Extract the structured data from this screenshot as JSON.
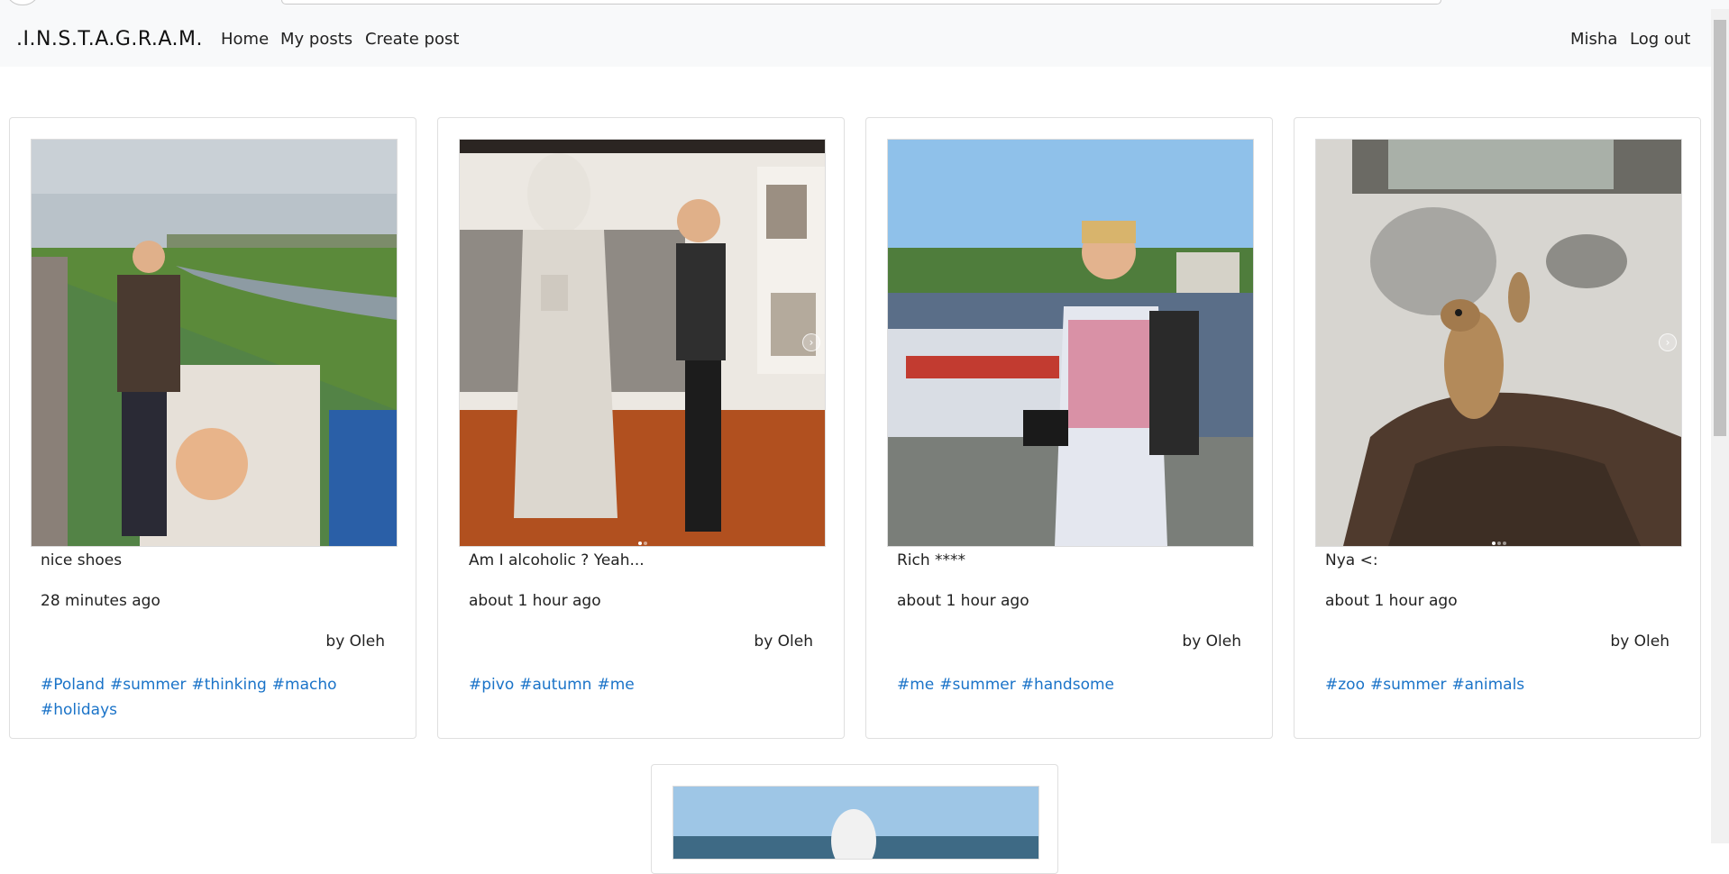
{
  "navbar": {
    "brand": ".I.N.S.T.A.G.R.A.M.",
    "links": [
      "Home",
      "My posts",
      "Create post"
    ],
    "user": "Misha",
    "logout": "Log out"
  },
  "posts": [
    {
      "caption": "nice shoes",
      "time": "28 minutes ago",
      "author": "by Oleh",
      "tags": [
        "#Poland",
        "#summer",
        "#thinking",
        "#macho",
        "#holidays"
      ],
      "has_carousel": false,
      "photo_icon": "riverside-photo"
    },
    {
      "caption": "Am I alcoholic ? Yeah...",
      "time": "about 1 hour ago",
      "author": "by Oleh",
      "tags": [
        "#pivo",
        "#autumn",
        "#me"
      ],
      "has_carousel": true,
      "photo_icon": "statue-photo"
    },
    {
      "caption": "Rich ****",
      "time": "about 1 hour ago",
      "author": "by Oleh",
      "tags": [
        "#me",
        "#summer",
        "#handsome"
      ],
      "has_carousel": false,
      "photo_icon": "river-boat-photo"
    },
    {
      "caption": "Nya <:",
      "time": "about 1 hour ago",
      "author": "by Oleh",
      "tags": [
        "#zoo",
        "#summer",
        "#animals"
      ],
      "has_carousel": true,
      "photo_icon": "meerkat-photo"
    }
  ],
  "colors": {
    "navbar_bg": "#f8f9fa",
    "tag_link": "#1a73c8",
    "card_border": "#dfdfdf"
  }
}
